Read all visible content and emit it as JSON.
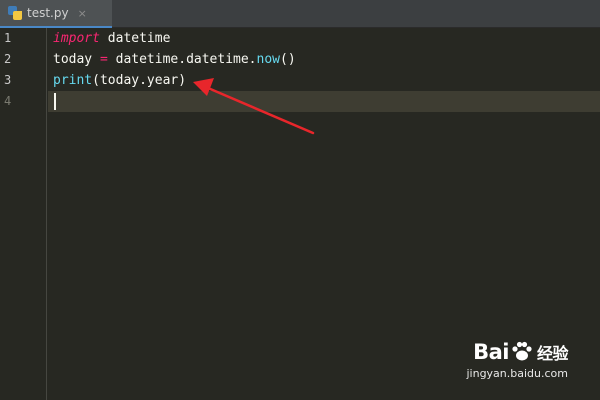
{
  "tab": {
    "filename": "test.py",
    "file_icon": "python-file-icon",
    "close_glyph": "×"
  },
  "gutter": {
    "line_numbers": [
      "1",
      "2",
      "3",
      "4"
    ]
  },
  "code": {
    "line1": {
      "keyword": "import",
      "module": " datetime"
    },
    "line2": {
      "var": "today ",
      "op": "=",
      "mid": " datetime.datetime.",
      "call": "now",
      "end": "()"
    },
    "line3": {
      "builtin": "print",
      "args": "(today.year)"
    }
  },
  "annotation": {
    "arrow_color": "#e8262b",
    "arrow_target": "print(today.year)"
  },
  "watermark": {
    "brand_left": "Bai",
    "brand_right": "经验",
    "url": "jingyan.baidu.com"
  },
  "colors": {
    "editor_bg": "#272822",
    "keyword": "#f92672",
    "function": "#66d9ef",
    "text": "#f8f8f2",
    "current_line": "#3e3d32"
  }
}
